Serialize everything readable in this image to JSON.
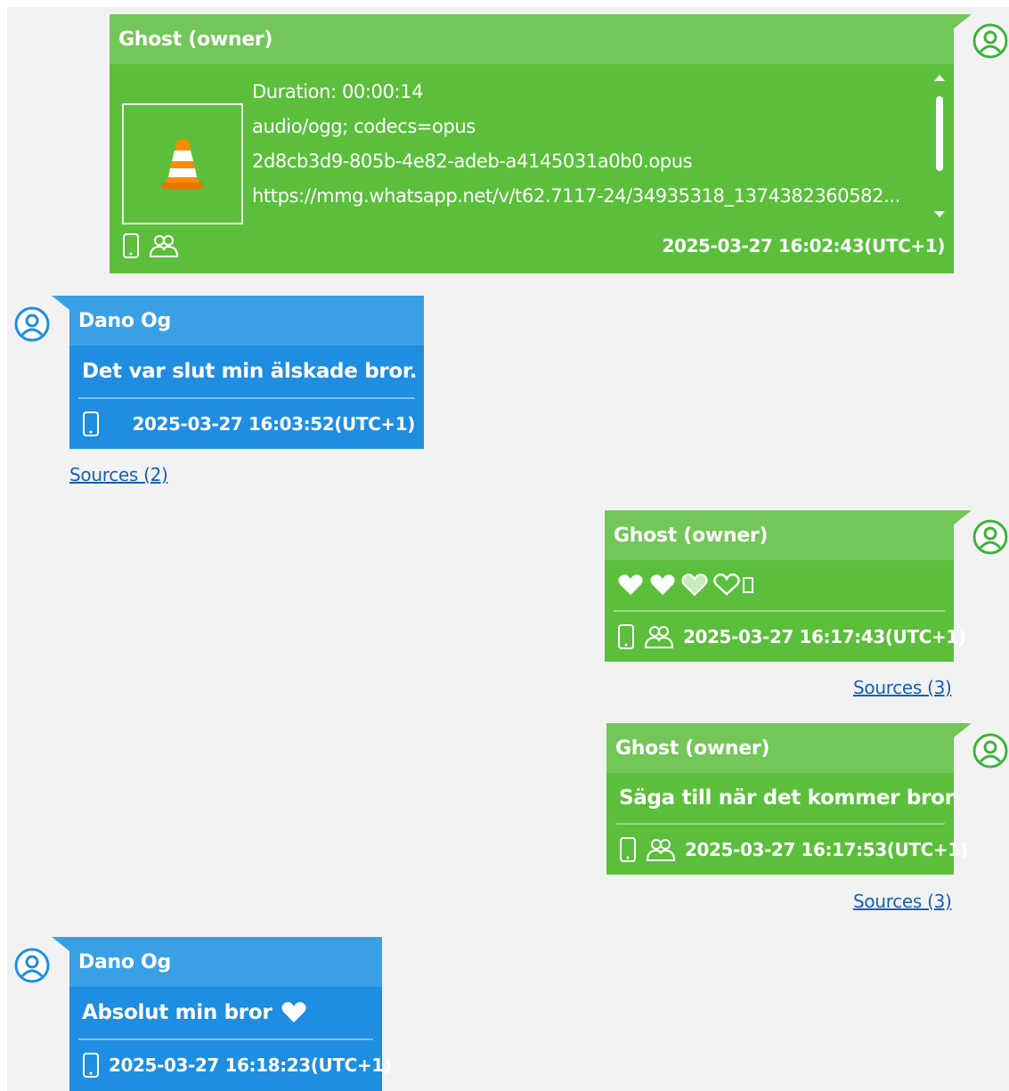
{
  "messages": [
    {
      "sender": "Ghost (owner)",
      "media": {
        "duration": "Duration: 00:00:14",
        "mime": "audio/ogg; codecs=opus",
        "filename": "2d8cb3d9-805b-4e82-adeb-a4145031a0b0.opus",
        "url": "https://mmg.whatsapp.net/v/t62.7117-24/34935318_1374382360582..."
      },
      "timestamp": "2025-03-27 16:02:43(UTC+1)"
    },
    {
      "sender": "Dano Og",
      "text": "Det var slut min älskade bror.",
      "timestamp": "2025-03-27 16:03:52(UTC+1)",
      "sources": "Sources (2)"
    },
    {
      "sender": "Ghost (owner)",
      "text": "",
      "timestamp": "2025-03-27 16:17:43(UTC+1)",
      "sources": "Sources (3)"
    },
    {
      "sender": "Ghost (owner)",
      "text": "Säga till när det kommer bror",
      "timestamp": "2025-03-27 16:17:53(UTC+1)",
      "sources": "Sources (3)"
    },
    {
      "sender": "Dano Og",
      "text": "Absolut min bror",
      "timestamp": "2025-03-27 16:18:23(UTC+1)"
    }
  ],
  "colors": {
    "owner_bubble": "#5bbf3c",
    "owner_header": "#73c758",
    "contact_bubble": "#1f8de0",
    "contact_header": "#3aa0e6",
    "link": "#1a5fb4",
    "owner_avatar": "#3db33a",
    "contact_avatar": "#1f8de0"
  },
  "icons": [
    "user-avatar-icon",
    "vlc-cone-icon",
    "phone-icon",
    "group-icon",
    "heart-icon"
  ]
}
